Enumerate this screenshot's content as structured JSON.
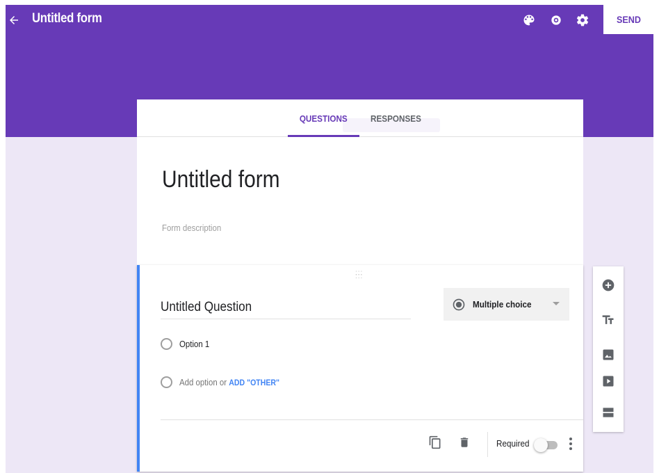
{
  "header": {
    "title": "Untitled form",
    "send_label": "SEND",
    "icons": [
      "back-arrow-icon",
      "palette-icon",
      "eye-icon",
      "gear-icon"
    ],
    "bg_color": "#673ab7"
  },
  "tabs": [
    {
      "label": "QUESTIONS",
      "active": true
    },
    {
      "label": "RESPONSES",
      "active": false
    }
  ],
  "form": {
    "title": "Untitled form",
    "description_placeholder": "Form description"
  },
  "question": {
    "title": "Untitled Question",
    "type_label": "Multiple choice",
    "options": [
      {
        "label": "Option 1"
      }
    ],
    "add_option_label": "Add option",
    "or_label": "or",
    "add_other_label": "ADD \"OTHER\"",
    "required_label": "Required",
    "required_on": false
  },
  "side_toolbar": [
    "add-question-icon",
    "add-title-icon",
    "add-image-icon",
    "add-video-icon",
    "add-section-icon"
  ],
  "colors": {
    "accent": "#673ab7",
    "background": "#ede7f6",
    "link_blue": "#4285f4"
  }
}
